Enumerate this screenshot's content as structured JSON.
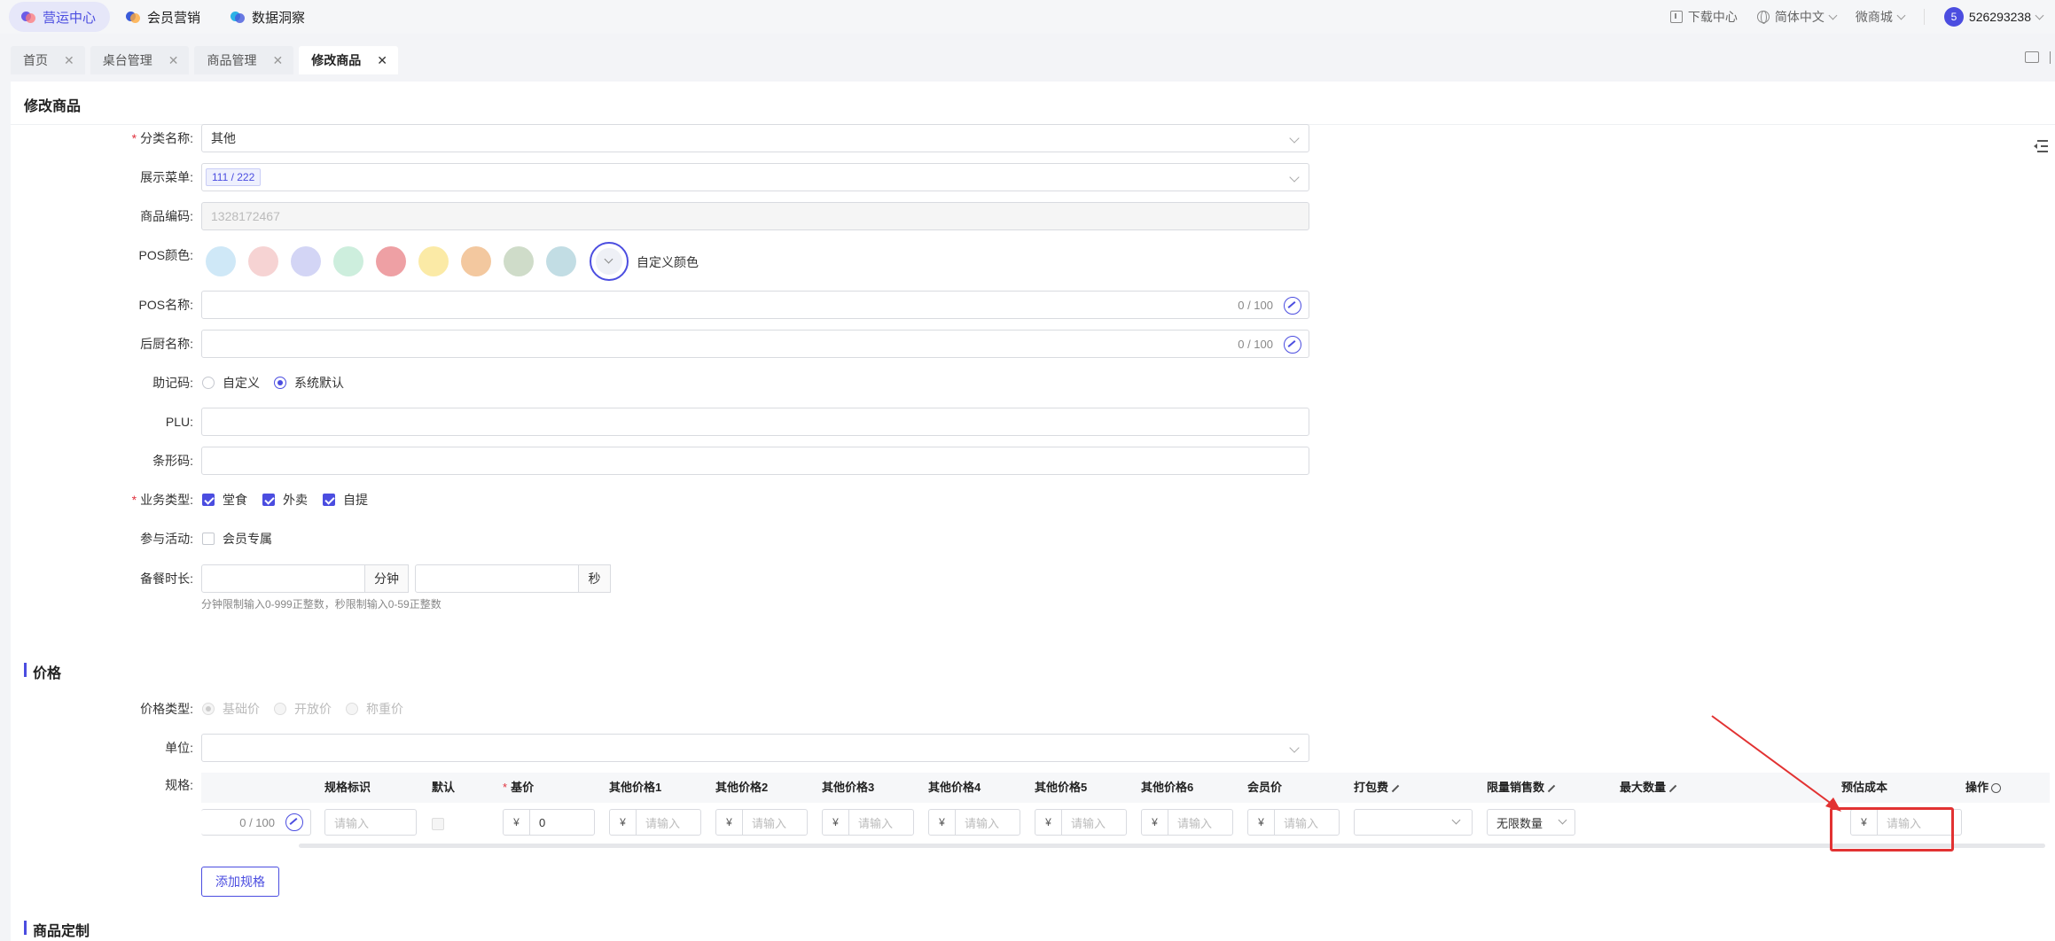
{
  "topnav": {
    "items": [
      {
        "label": "营运中心",
        "active": true
      },
      {
        "label": "会员营销",
        "active": false
      },
      {
        "label": "数据洞察",
        "active": false
      }
    ],
    "download": "下载中心",
    "language": "简体中文",
    "store": "微商城",
    "avatar_letter": "5",
    "account": "526293238"
  },
  "tabs": [
    {
      "label": "首页",
      "active": false
    },
    {
      "label": "桌台管理",
      "active": false
    },
    {
      "label": "商品管理",
      "active": false
    },
    {
      "label": "修改商品",
      "active": true
    }
  ],
  "page_title": "修改商品",
  "form": {
    "category": {
      "label": "分类名称:",
      "value": "其他"
    },
    "menu": {
      "label": "展示菜单:",
      "tag": "111 / 222"
    },
    "code": {
      "label": "商品编码:",
      "value": "1328172467"
    },
    "pos_color": {
      "label": "POS颜色:",
      "swatches": [
        "#cfe8f7",
        "#f6d3d3",
        "#d3d5f5",
        "#cdeedd",
        "#eea0a4",
        "#fbeaa6",
        "#f3c89f",
        "#cfdcc9",
        "#c2dde4"
      ],
      "custom_label": "自定义颜色"
    },
    "pos_name": {
      "label": "POS名称:",
      "count": "0 / 100"
    },
    "kitchen_name": {
      "label": "后厨名称:",
      "count": "0 / 100"
    },
    "mnemonic": {
      "label": "助记码:",
      "options": [
        "自定义",
        "系统默认"
      ],
      "selected": "系统默认"
    },
    "plu": {
      "label": "PLU:"
    },
    "barcode": {
      "label": "条形码:"
    },
    "biz_type": {
      "label": "业务类型:",
      "options": [
        "堂食",
        "外卖",
        "自提"
      ]
    },
    "activity": {
      "label": "参与活动:",
      "option": "会员专属"
    },
    "prep_time": {
      "label": "备餐时长:",
      "minute_unit": "分钟",
      "second_unit": "秒",
      "hint": "分钟限制输入0-999正整数，秒限制输入0-59正整数"
    }
  },
  "price_section": {
    "title": "价格",
    "price_type": {
      "label": "价格类型:",
      "options": [
        "基础价",
        "开放价",
        "称重价"
      ],
      "selected": "基础价"
    },
    "unit": {
      "label": "单位:"
    },
    "spec": {
      "label": "规格:",
      "headers": [
        "规格标识",
        "默认",
        "基价",
        "其他价格1",
        "其他价格2",
        "其他价格3",
        "其他价格4",
        "其他价格5",
        "其他价格6",
        "会员价",
        "打包费",
        "限量销售数",
        "最大数量",
        "预估成本",
        "操作"
      ],
      "name_count": "0 / 100",
      "placeholder": "请输入",
      "base_price": "0",
      "currency": "¥",
      "limit_value": "无限数量"
    },
    "add_button": "添加规格"
  },
  "custom_section": {
    "title": "商品定制"
  }
}
